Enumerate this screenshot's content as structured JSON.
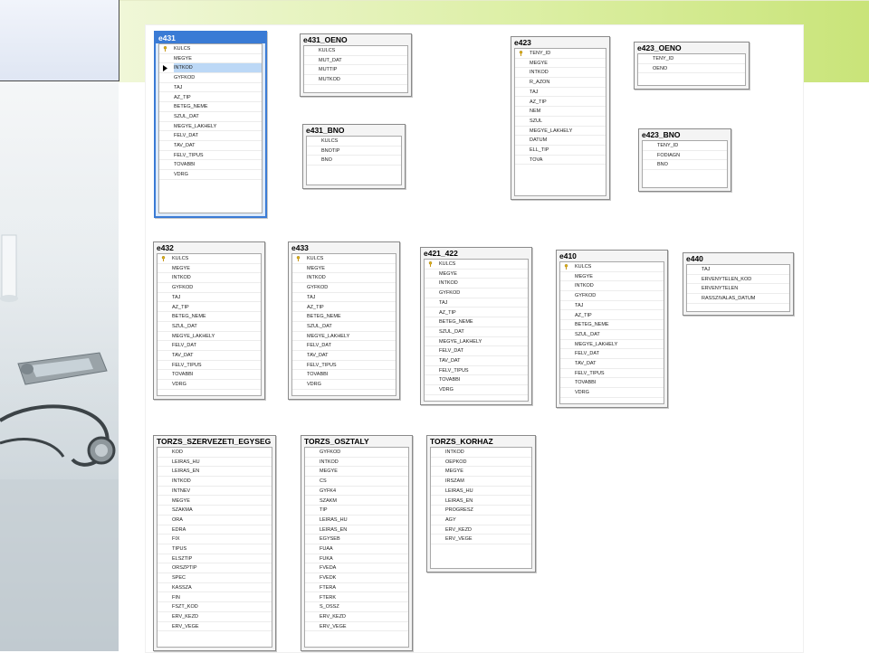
{
  "tables": [
    {
      "id": "e431",
      "title": "e431",
      "selected": true,
      "key_rows": [
        0
      ],
      "highlight_row": 2,
      "columns": [
        "KULCS",
        "MEGYE",
        "INTKOD",
        "GYFKOD",
        "TAJ",
        "AZ_TIP",
        "BETEG_NEME",
        "SZUL_DAT",
        "MEGYE_LAKHELY",
        "FELV_DAT",
        "TAV_DAT",
        "FELV_TIPUS",
        "TOVABBI",
        "VDRG"
      ]
    },
    {
      "id": "e431_OENO",
      "title": "e431_OENO",
      "key_rows": [],
      "columns": [
        "KULCS",
        "MUT_DAT",
        "MUTTIP",
        "MUTKOD"
      ]
    },
    {
      "id": "e431_BNO",
      "title": "e431_BNO",
      "key_rows": [],
      "columns": [
        "KULCS",
        "BNOTIP",
        "BNO"
      ]
    },
    {
      "id": "e423",
      "title": "e423",
      "key_rows": [
        0
      ],
      "columns": [
        "TENY_ID",
        "MEGYE",
        "INTKOD",
        "R_AZON",
        "TAJ",
        "AZ_TIP",
        "NEM",
        "SZUL",
        "MEGYE_LAKHELY",
        "DATUM",
        "ELL_TIP",
        "TOVA"
      ]
    },
    {
      "id": "e423_OENO",
      "title": "e423_OENO",
      "key_rows": [],
      "columns": [
        "TENY_ID",
        "OENO"
      ]
    },
    {
      "id": "e423_BNO",
      "title": "e423_BNO",
      "key_rows": [],
      "columns": [
        "TENY_ID",
        "FODIAGN",
        "BNO"
      ]
    },
    {
      "id": "e432",
      "title": "e432",
      "key_rows": [
        0
      ],
      "columns": [
        "KULCS",
        "MEGYE",
        "INTKOD",
        "GYFKOD",
        "TAJ",
        "AZ_TIP",
        "BETEG_NEME",
        "SZUL_DAT",
        "MEGYE_LAKHELY",
        "FELV_DAT",
        "TAV_DAT",
        "FELV_TIPUS",
        "TOVABBI",
        "VDRG"
      ]
    },
    {
      "id": "e433",
      "title": "e433",
      "key_rows": [
        0
      ],
      "columns": [
        "KULCS",
        "MEGYE",
        "INTKOD",
        "GYFKOD",
        "TAJ",
        "AZ_TIP",
        "BETEG_NEME",
        "SZUL_DAT",
        "MEGYE_LAKHELY",
        "FELV_DAT",
        "TAV_DAT",
        "FELV_TIPUS",
        "TOVABBI",
        "VDRG"
      ]
    },
    {
      "id": "e421_422",
      "title": "e421_422",
      "key_rows": [
        0
      ],
      "columns": [
        "KULCS",
        "MEGYE",
        "INTKOD",
        "GYFKOD",
        "TAJ",
        "AZ_TIP",
        "BETEG_NEME",
        "SZUL_DAT",
        "MEGYE_LAKHELY",
        "FELV_DAT",
        "TAV_DAT",
        "FELV_TIPUS",
        "TOVABBI",
        "VDRG"
      ]
    },
    {
      "id": "e410",
      "title": "e410",
      "key_rows": [
        0
      ],
      "columns": [
        "KULCS",
        "MEGYE",
        "INTKOD",
        "GYFKOD",
        "TAJ",
        "AZ_TIP",
        "BETEG_NEME",
        "SZUL_DAT",
        "MEGYE_LAKHELY",
        "FELV_DAT",
        "TAV_DAT",
        "FELV_TIPUS",
        "TOVABBI",
        "VDRG"
      ]
    },
    {
      "id": "e440",
      "title": "e440",
      "key_rows": [],
      "columns": [
        "TAJ",
        "ERVENYTELEN_KOD",
        "ERVENYTELEN",
        "RASSZIVALAS_DATUM"
      ]
    },
    {
      "id": "TORZS_SZERVEZETI_EGYSEG",
      "title": "TORZS_SZERVEZETI_EGYSEG",
      "key_rows": [],
      "columns": [
        "KOD",
        "LEIRAS_HU",
        "LEIRAS_EN",
        "INTKOD",
        "INTNEV",
        "MEGYE",
        "SZAKMA",
        "ORA",
        "EDRA",
        "FIX",
        "TIPUS",
        "ELSZTIP",
        "ORSZPTIP",
        "SPEC",
        "KASSZA",
        "FIN",
        "FSZT_KOD",
        "ERV_KEZD",
        "ERV_VEGE"
      ]
    },
    {
      "id": "TORZS_OSZTALY",
      "title": "TORZS_OSZTALY",
      "key_rows": [],
      "columns": [
        "GYFKOD",
        "INTKOD",
        "MEGYE",
        "CS",
        "GYFK4",
        "SZAKM",
        "TIP",
        "LEIRAS_HU",
        "LEIRAS_EN",
        "EGYSEB",
        "FUAA",
        "FUKA",
        "FVEDA",
        "FVEDK",
        "FTERA",
        "FTERK",
        "S_OSSZ",
        "ERV_KEZD",
        "ERV_VEGE"
      ]
    },
    {
      "id": "TORZS_KORHAZ",
      "title": "TORZS_KORHAZ",
      "key_rows": [],
      "columns": [
        "INTKOD",
        "OEPKOD",
        "MEGYE",
        "IRSZAM",
        "LEIRAS_HU",
        "LEIRAS_EN",
        "PROGRESZ",
        "AGY",
        "ERV_KEZD",
        "ERV_VEGE"
      ]
    }
  ],
  "icons": {
    "key": "key-icon",
    "row_selector": "row-selector-icon"
  },
  "colors": {
    "banner_green": "#c9e479",
    "selection_blue": "#3a7bd5"
  }
}
